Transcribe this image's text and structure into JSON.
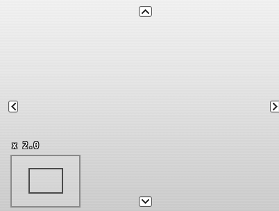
{
  "viewer": {
    "zoom_level_label": "x 2.0",
    "zoom_value": 2.0
  },
  "icons": {
    "pan_up": "chevron-up-icon",
    "pan_down": "chevron-down-icon",
    "pan_left": "chevron-left-icon",
    "pan_right": "chevron-right-icon"
  },
  "colors": {
    "background_top": "#f1f1f1",
    "background_bottom": "#cbcbcb",
    "button_fill": "#ffffff",
    "button_border": "#585858",
    "navigator_border": "#8a8a8a",
    "viewport_border": "#4a4a4a"
  }
}
